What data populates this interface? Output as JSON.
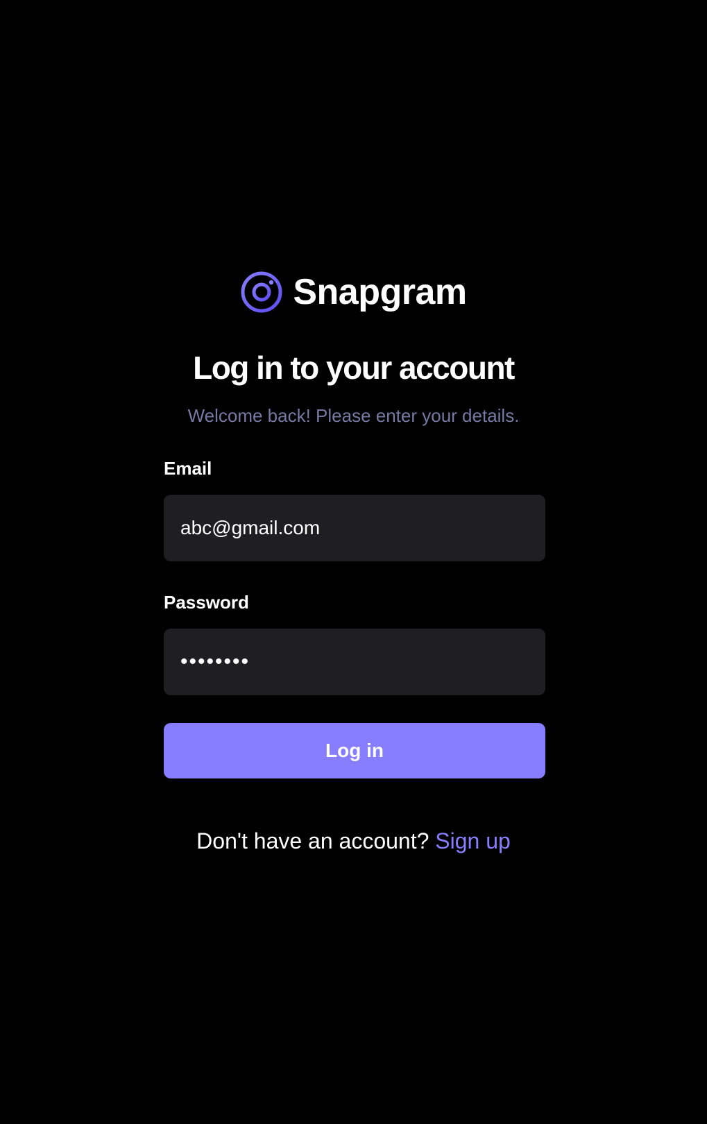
{
  "brand": {
    "name": "Snapgram",
    "icon": "snapgram-logo-icon",
    "accent_color": "#877eff"
  },
  "header": {
    "title": "Log in to your account",
    "subtitle": "Welcome back! Please enter your details."
  },
  "form": {
    "email": {
      "label": "Email",
      "value": "abc@gmail.com"
    },
    "password": {
      "label": "Password",
      "value": "••••••••"
    },
    "submit_label": "Log in"
  },
  "footer": {
    "prompt": "Don't have an account?",
    "link_label": "Sign up"
  },
  "colors": {
    "background": "#000000",
    "input_background": "#1f1f22",
    "subtitle": "#7878a3",
    "primary": "#877eff"
  }
}
